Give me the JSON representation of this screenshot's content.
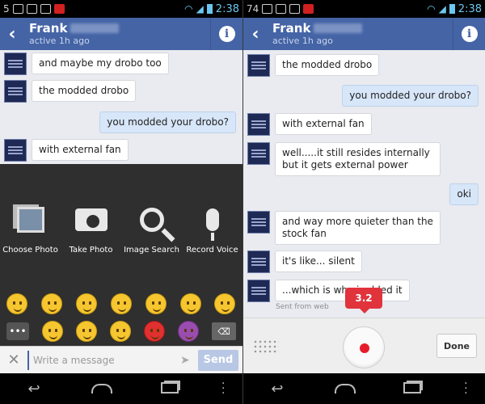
{
  "left": {
    "status": {
      "time": "2:38",
      "num": "5"
    },
    "header": {
      "name": "Frank",
      "subtitle": "active 1h ago",
      "info": "i",
      "back": "‹"
    },
    "messages": [
      {
        "text": "and maybe my drobo too",
        "from": "them"
      },
      {
        "text": "the modded drobo",
        "from": "them"
      },
      {
        "text": "you modded your drobo?",
        "from": "me"
      },
      {
        "text": "with external fan",
        "from": "them"
      }
    ],
    "attach_options": [
      {
        "label": "Choose Photo",
        "icon": "photos-icon"
      },
      {
        "label": "Take Photo",
        "icon": "camera-icon"
      },
      {
        "label": "Image Search",
        "icon": "magnifier-icon"
      },
      {
        "label": "Record Voice",
        "icon": "microphone-icon"
      }
    ],
    "composer": {
      "placeholder": "Write a message",
      "send": "Send",
      "close": "✕"
    }
  },
  "right": {
    "status": {
      "time": "2:38",
      "num": "74"
    },
    "header": {
      "name": "Frank",
      "subtitle": "active 1h ago",
      "info": "i",
      "back": "‹"
    },
    "messages": [
      {
        "text": "the modded drobo",
        "from": "them"
      },
      {
        "text": "you modded your drobo?",
        "from": "me"
      },
      {
        "text": "with external fan",
        "from": "them"
      },
      {
        "text": "well.....it still resides internally but it gets external power",
        "from": "them"
      },
      {
        "text": "oki",
        "from": "me"
      },
      {
        "text": "and way more quieter than the stock fan",
        "from": "them"
      },
      {
        "text": "it's like... silent",
        "from": "them"
      },
      {
        "text": "...which is why i added it",
        "from": "them"
      }
    ],
    "sent_from": "Sent from web",
    "timer": "3.2",
    "done": "Done"
  },
  "colors": {
    "header": "#4564a6",
    "accent_red": "#e0333c",
    "my_bubble": "#d7e6f8"
  }
}
